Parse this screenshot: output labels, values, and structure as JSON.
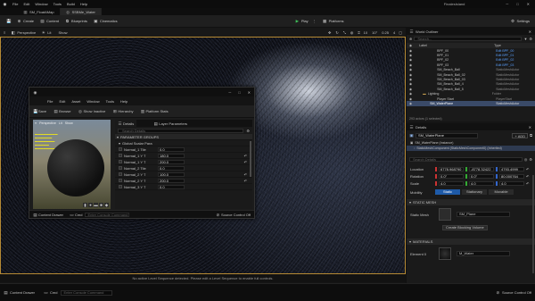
{
  "main_menu": {
    "items": [
      "File",
      "Edit",
      "Window",
      "Tools",
      "Build",
      "Help"
    ],
    "project_name": "FinalesIsland"
  },
  "doc_tabs": [
    {
      "label": "SM_FloatAMap"
    },
    {
      "label": "SSBMe_Water"
    }
  ],
  "toolbar": {
    "save": "",
    "create": "Create",
    "content": "Content",
    "blueprints": "Blueprints",
    "cinematics": "Cinematics",
    "play": "Play",
    "platforms": "Platforms",
    "settings": "Settings"
  },
  "viewport_bar": {
    "perspective": "Perspective",
    "lit": "Lit",
    "show": "Show",
    "fov": "0.25",
    "snap_grid": "10",
    "snap_rot": "10°",
    "snap_scale": "0.25",
    "cam_speed": "4"
  },
  "viewport_message": "No active Level Sequence detected. Please edit a Level Sequence to enable full controls.",
  "status_bar": {
    "content_drawer": "Content Drawer",
    "output_log": "Cmd",
    "console_placeholder": "Enter Console Command",
    "source_control": "Source Control Off"
  },
  "material_window": {
    "title": "SM_WaterPlane",
    "menu": [
      "File",
      "Edit",
      "Asset",
      "Window",
      "Tools",
      "Help"
    ],
    "toolbar": {
      "save": "Save",
      "browse": "Browse",
      "show_inactive": "Show Inactive",
      "hierarchy": "Hierarchy",
      "platform_stats": "Platform Stats"
    },
    "preview": {
      "perspective": "Perspective",
      "lit": "Lit",
      "show": "Show"
    },
    "details": {
      "tab_details": "Details",
      "tab_layer": "Layer Parameters",
      "search_placeholder": "Search Details",
      "group_header": "PARAMETER GROUPS",
      "subgroup": "Global Scalar Para",
      "params": [
        {
          "name": "Normal_1 Tile",
          "value": "0.0"
        },
        {
          "name": "Normal_1 Y T",
          "value": "180.0"
        },
        {
          "name": "Normal_1 Y T",
          "value": "200.0"
        },
        {
          "name": "Normal_2 Tile",
          "value": "0.0"
        },
        {
          "name": "Normal_2 Y T",
          "value": "100.0"
        },
        {
          "name": "Normal_2 Y T",
          "value": "200.0"
        },
        {
          "name": "Normal_3 Y T",
          "value": "0.0"
        }
      ]
    },
    "status_bar": {
      "content_drawer": "Content Drawer",
      "output_log": "Cmd",
      "console_placeholder": "Enter Console Command",
      "source_control": "Source Control Off"
    }
  },
  "outliner": {
    "title": "World Outliner",
    "search_placeholder": "Search...",
    "col_label": "Label",
    "col_type": "Type",
    "rows": [
      {
        "label": "BPF_00",
        "type": "Edit BPF_00",
        "sel": false
      },
      {
        "label": "BPF_01",
        "type": "Edit BPF_01",
        "sel": false
      },
      {
        "label": "BPF_02",
        "type": "Edit BPF_02",
        "sel": false
      },
      {
        "label": "BPF_03",
        "type": "Edit BPF_03",
        "sel": false
      },
      {
        "label": "SM_Beach_Ball",
        "type": "StaticMeshActor",
        "sel": false
      },
      {
        "label": "SM_Beach_Ball_02",
        "type": "StaticMeshActor",
        "sel": false
      },
      {
        "label": "SM_Beach_Ball_03",
        "type": "StaticMeshActor",
        "sel": false
      },
      {
        "label": "SM_Beach_Ball_4",
        "type": "StaticMeshActor",
        "sel": false
      },
      {
        "label": "SM_Beach_Ball_5",
        "type": "StaticMeshActor",
        "sel": false
      },
      {
        "label": "Lighting",
        "type": "Folder",
        "sel": false
      },
      {
        "label": "Player Start",
        "type": "PlayerStart",
        "sel": false
      },
      {
        "label": "SM_WaterPlane",
        "type": "StaticMeshActor",
        "sel": true
      }
    ],
    "footer": "293 actors (1 selected)"
  },
  "details_panel": {
    "title": "Details",
    "actor_name": "SM_WaterPlane",
    "add_button": "+ ADD",
    "component_root": "SM_WaterPlane (Instance)",
    "component_child": "StaticMeshComponent (StaticMeshComponent0) (Inherited)",
    "search_placeholder": "Search Details",
    "transform": [
      {
        "label": "Location",
        "x": "6778.968790",
        "y": "-8778.32422",
        "z": "4793.4999"
      },
      {
        "label": "Rotation",
        "x": "0.0°",
        "y": "0.0°",
        "z": "80.000764"
      },
      {
        "label": "Scale",
        "x": "4.0",
        "y": "4.0",
        "z": "4.0"
      }
    ],
    "mobility_label": "Mobility",
    "mobility": [
      "Static",
      "Stationary",
      "Movable"
    ],
    "static_mesh_section": "STATIC MESH",
    "static_mesh_label": "Static Mesh",
    "static_mesh_value": "SM_Plane",
    "mesh_lod_button": "Create Blocking Volume",
    "materials_section": "MATERIALS",
    "element_label": "Element 0",
    "element_value": "M_Water"
  },
  "colors": {
    "accent": "#1e7bd6",
    "play": "#2ea043",
    "selection": "#3a4a68",
    "stats_text": "#e8e020",
    "viewport_border": "#b68a34"
  }
}
